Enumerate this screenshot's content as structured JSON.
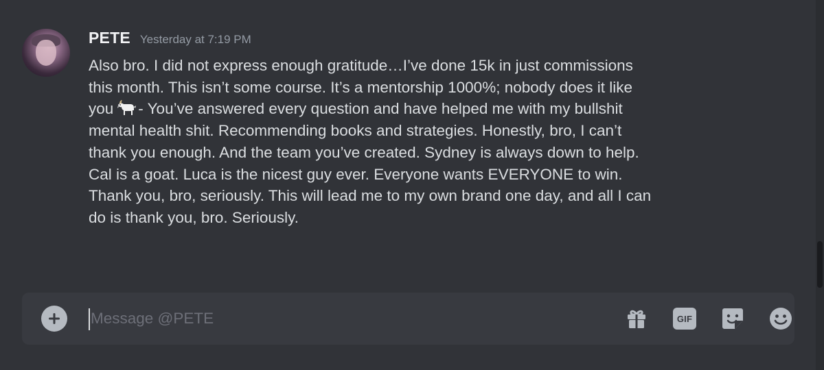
{
  "message": {
    "author": "PETE",
    "timestamp": "Yesterday at 7:19 PM",
    "lines": [
      "Also bro. I did not express enough gratitude…I’ve done 15k in just commissions",
      "this month. This isn’t some course. It’s a mentorship 1000%; nobody does it like",
      "you",
      "- You’ve answered every question and have helped me with my bullshit",
      "mental health shit. Recommending books and strategies. Honestly, bro, I can’t",
      "thank you enough. And the team you’ve created. Sydney is always down to help.",
      "Cal is a goat. Luca is the nicest guy ever. Everyone wants EVERYONE to win.",
      "Thank you, bro, seriously. This will lead me to my own brand one day, and all I can",
      "do is thank you, bro. Seriously."
    ],
    "emoji": "goat-emoji"
  },
  "composer": {
    "placeholder": "Message @PETE",
    "value": "",
    "gif_label": "GIF"
  },
  "icons": {
    "add": "plus-circle-icon",
    "gift": "gift-icon",
    "gif": "gif-icon",
    "sticker": "sticker-icon",
    "emoji": "smiley-icon"
  },
  "colors": {
    "background": "#313338",
    "composer": "#383a40",
    "text": "#dbdee1",
    "muted": "#949ba4",
    "icon": "#b5bac1"
  }
}
